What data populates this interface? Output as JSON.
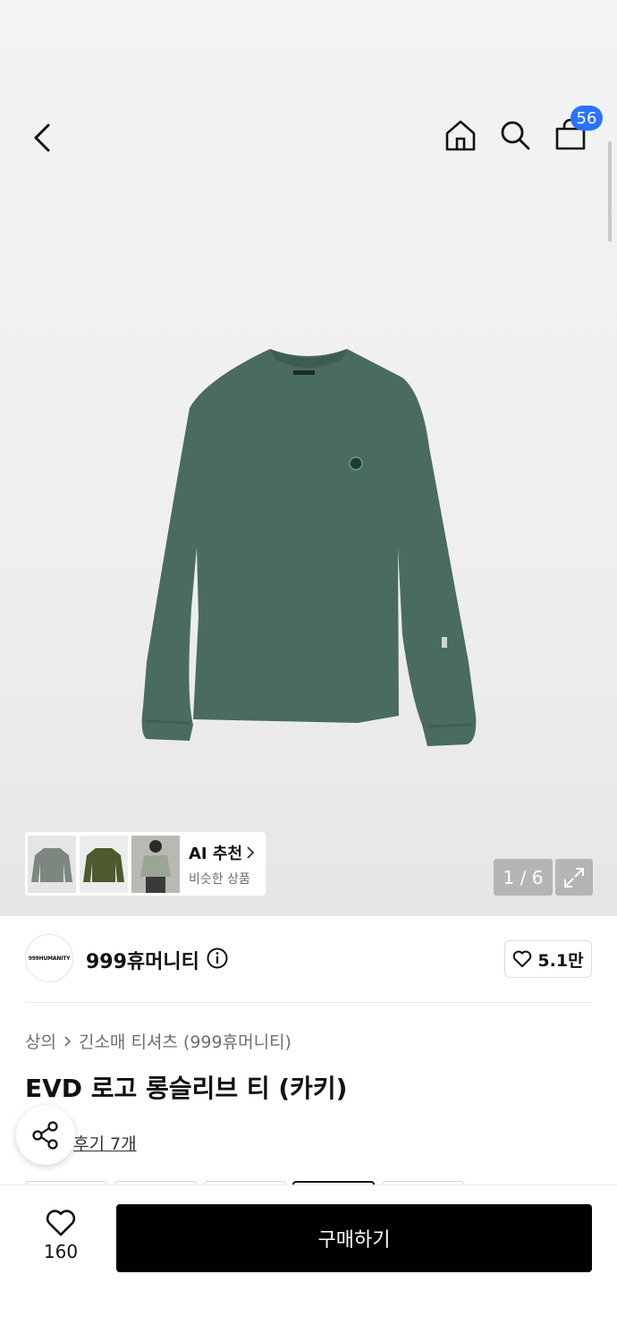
{
  "header": {
    "cart_count": "56"
  },
  "gallery": {
    "counter": "1 / 6",
    "ai_recommend": {
      "title": "AI 추천",
      "subtitle": "비슷한 상품"
    }
  },
  "brand": {
    "logo_text": "999HUMANITY",
    "name": "999휴머니티",
    "likes": "5.1만"
  },
  "product": {
    "breadcrumb": [
      "상의",
      "긴소매 티셔츠 (999휴머니티)"
    ],
    "title": "EVD 로고 롱슬리브 티 (카키)",
    "review_text": "후기 7개"
  },
  "bottom": {
    "wish_count": "160",
    "buy_label": "구매하기"
  },
  "colors": {
    "badge": "#2a72ff",
    "garment": "#4a6b60",
    "buy_button": "#000000"
  }
}
